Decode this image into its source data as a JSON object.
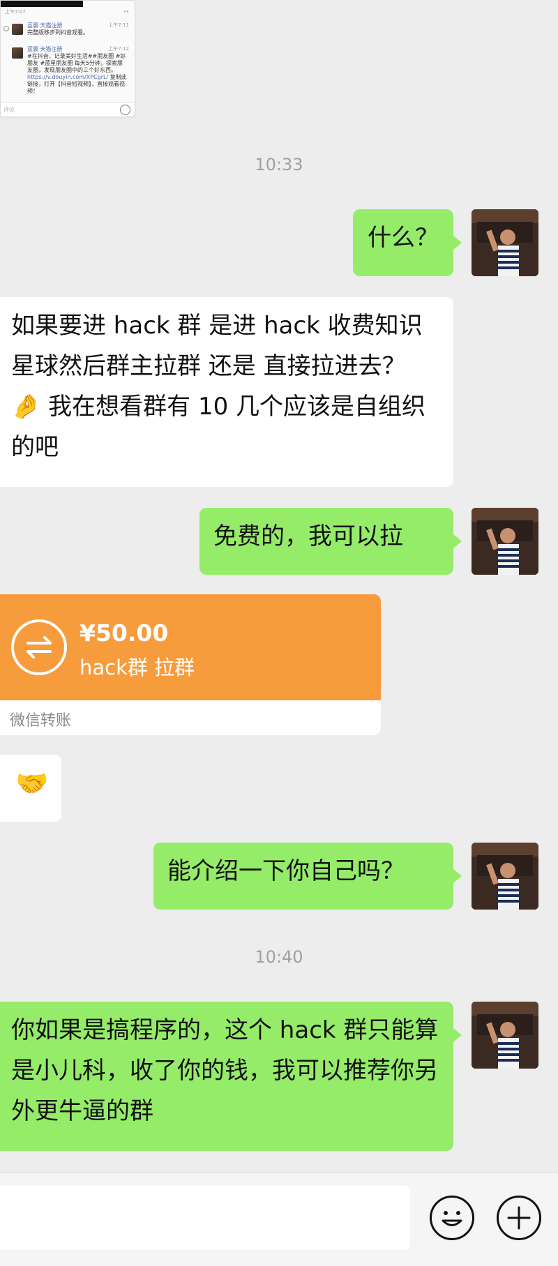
{
  "quoted_screenshot": {
    "status_time": "上午7:07",
    "items": [
      {
        "name": "蓝晨 天猫注册",
        "time": "上午7:11",
        "text": "完整版移步到抖音观看。"
      },
      {
        "name": "蓝晨 天猫注册",
        "time": "上午7:12",
        "text": "#在抖音，记录美好生活##朋友圈 #好朋友 #蓝星朋友圈 每天5分钟，探索朋友圈，发现朋友圈中的三个好东西。",
        "link": "https://v.douyin.com/XPCgrL/",
        "text2": "复制此链接，打开【抖音短视频】，直接观看视频！"
      }
    ],
    "comment_placeholder": "评论"
  },
  "timestamps": [
    "10:33",
    "10:40"
  ],
  "messages": {
    "m1": "什么？",
    "m2": "如果要进 hack 群 是进 hack 收费知识星球然后群主拉群 还是 直接拉进去？ 🤌 我在想看群有 10 几个应该是自组织的吧",
    "m3": "免费的，我可以拉",
    "m5": "🤝",
    "m6": "能介绍一下你自己吗？",
    "m7": "你如果是搞程序的，这个 hack 群只能算是小儿科，收了你的钱，我可以推荐你另外更牛逼的群"
  },
  "transfer": {
    "amount": "¥50.00",
    "note": "hack群 拉群",
    "label": "微信转账",
    "color": "#f79c3c"
  },
  "colors": {
    "sent_bubble": "#95ec69",
    "received_bubble": "#ffffff",
    "background": "#ededed"
  },
  "input_bar": {
    "emoji_icon": "smiley-icon",
    "more_icon": "plus-circle-icon"
  }
}
